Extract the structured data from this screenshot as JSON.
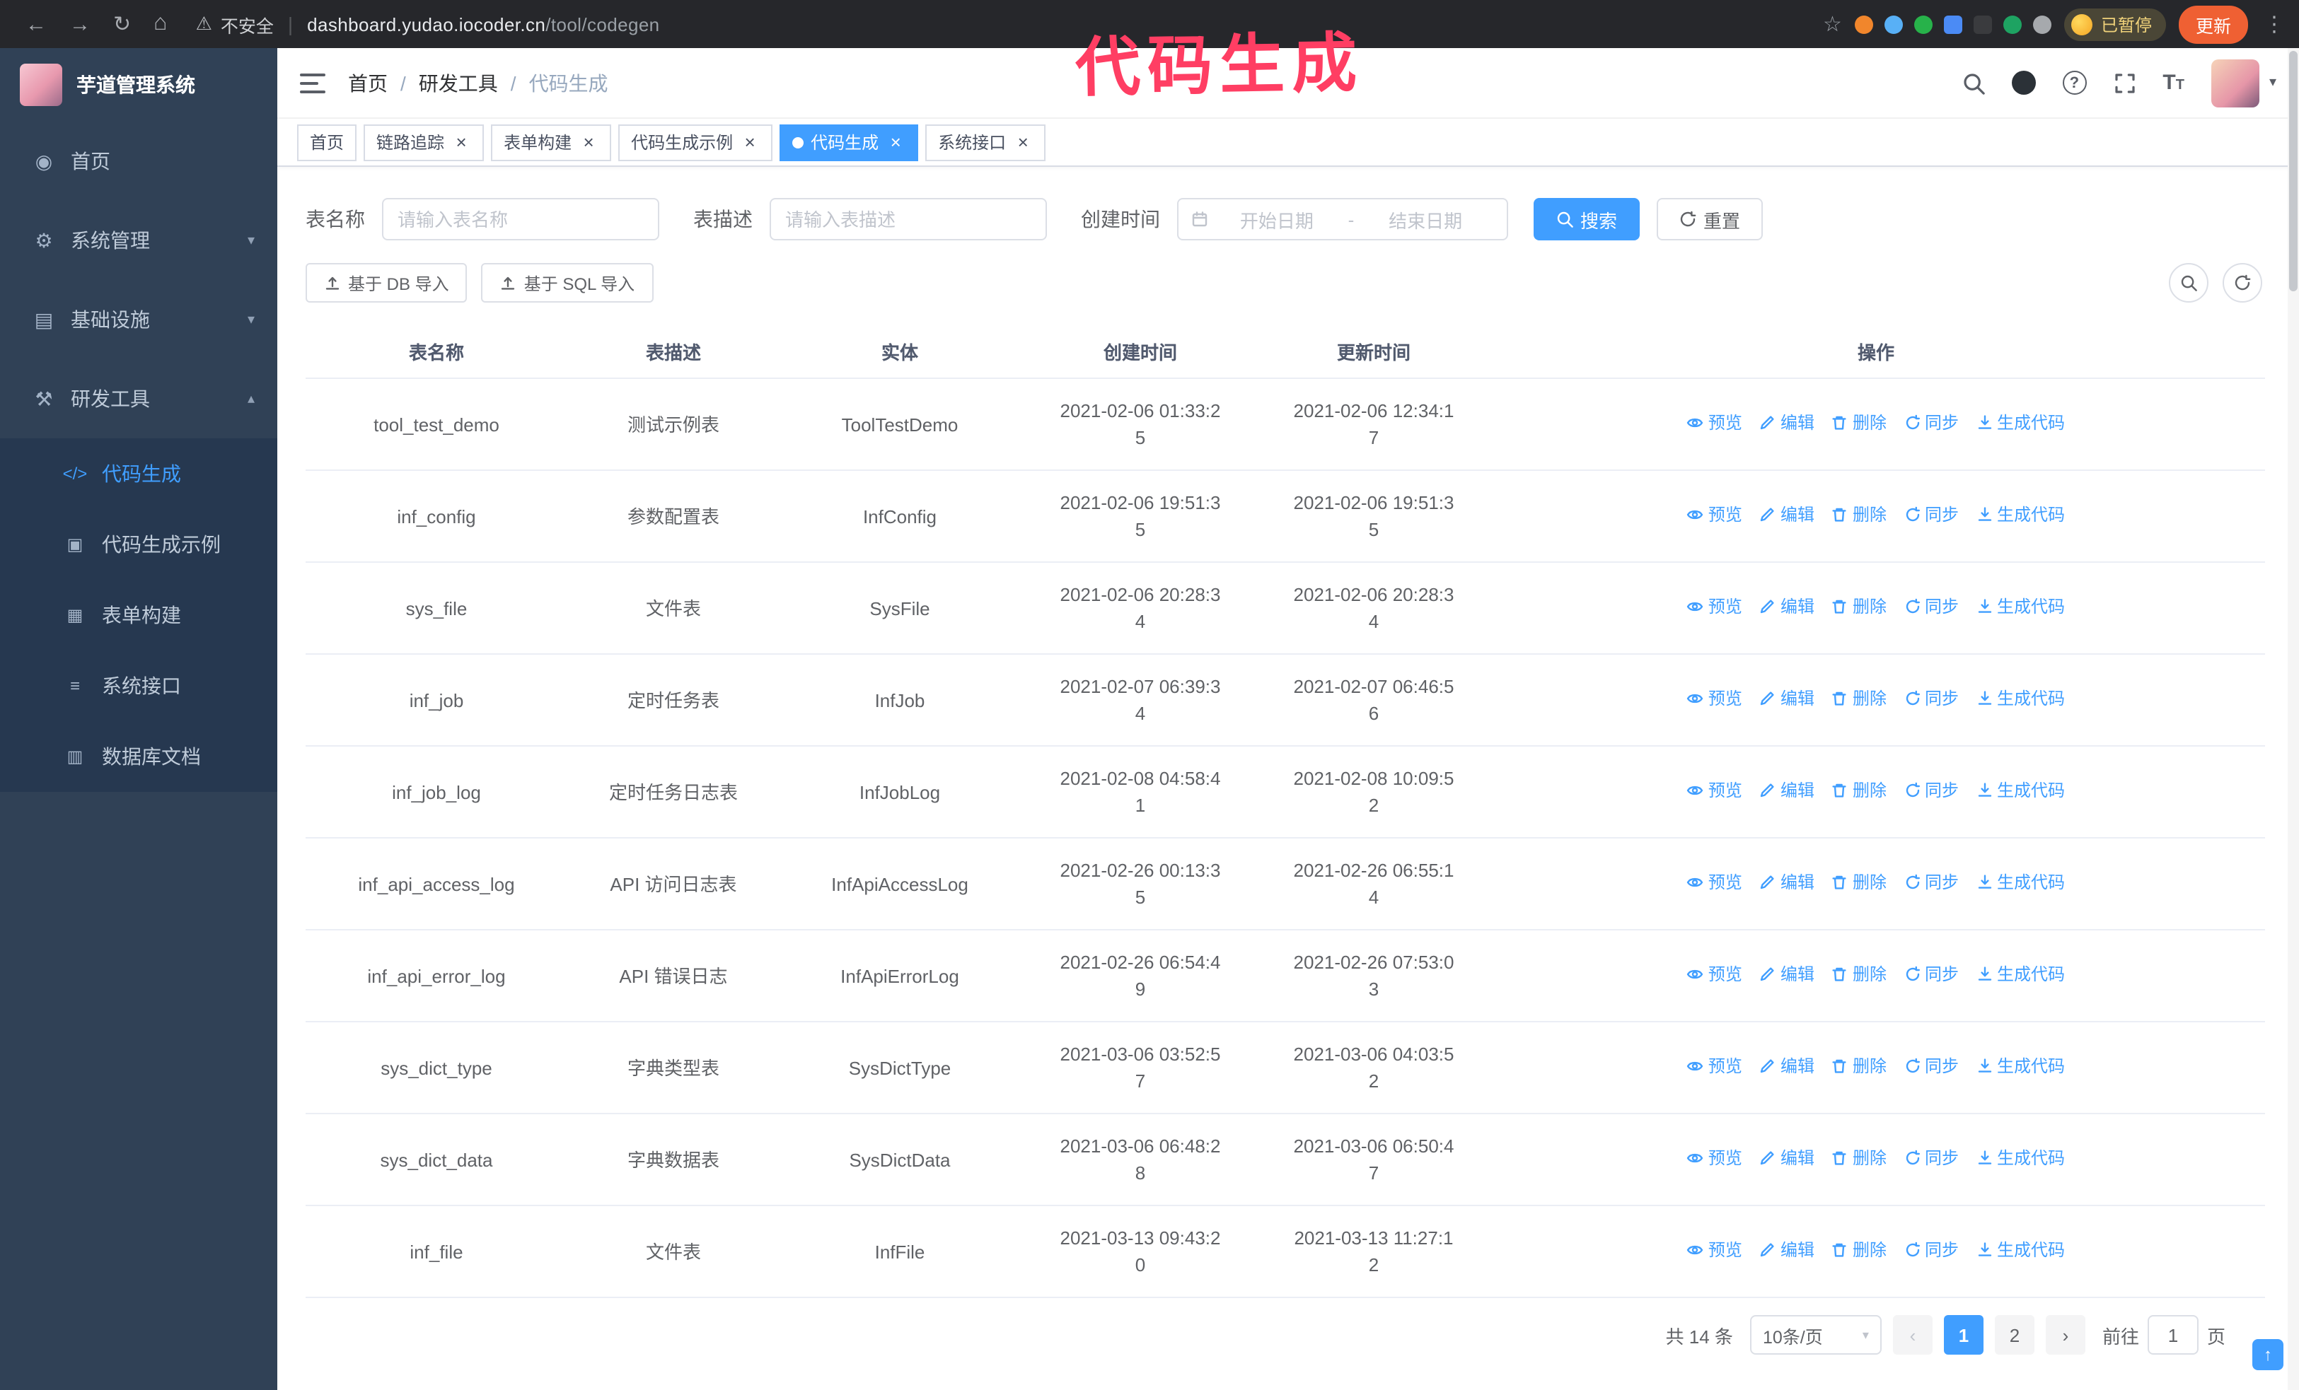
{
  "theme": {
    "primary": "#409eff",
    "sidebar_bg": "#304156",
    "submenu_bg": "#263850",
    "annotation_color": "#ff3e63"
  },
  "annotation": {
    "text": "代码生成"
  },
  "browser": {
    "security_text": "不安全",
    "url_host": "dashboard.yudao.iocoder.cn",
    "url_path": "/tool/codegen",
    "paused_badge": "已暂停",
    "update_button": "更新",
    "extensions": [
      {
        "icon": "extension-icon",
        "color": "#f1862c",
        "shape": "circle"
      },
      {
        "icon": "extension-icon",
        "color": "#58b0f6",
        "shape": "circle"
      },
      {
        "icon": "extension-icon",
        "color": "#27b24a",
        "shape": "circle"
      },
      {
        "icon": "extension-icon",
        "color": "#4b8bf5",
        "shape": "square"
      },
      {
        "icon": "extension-icon",
        "color": "#3a3b3e",
        "shape": "square"
      },
      {
        "icon": "extension-icon",
        "color": "#1ea362",
        "shape": "circle"
      },
      {
        "icon": "puzzle-icon",
        "color": "#a6a9ad",
        "shape": "circle"
      }
    ]
  },
  "sidebar": {
    "logo_title": "芋道管理系统",
    "items": [
      {
        "label": "首页",
        "icon": "dashboard-icon",
        "glyph": "◉"
      },
      {
        "label": "系统管理",
        "icon": "gear-icon",
        "glyph": "⚙",
        "chevron": "down"
      },
      {
        "label": "基础设施",
        "icon": "infrastructure-icon",
        "glyph": "▤",
        "chevron": "down"
      },
      {
        "label": "研发工具",
        "icon": "tools-icon",
        "glyph": "⚒",
        "chevron": "up",
        "expanded": true,
        "children": [
          {
            "label": "代码生成",
            "icon": "code-icon",
            "glyph": "</>",
            "active": true
          },
          {
            "label": "代码生成示例",
            "icon": "code-example-icon",
            "glyph": "▣",
            "active": false
          },
          {
            "label": "表单构建",
            "icon": "form-builder-icon",
            "glyph": "▦",
            "active": false
          },
          {
            "label": "系统接口",
            "icon": "api-icon",
            "glyph": "≡",
            "active": false
          },
          {
            "label": "数据库文档",
            "icon": "db-doc-icon",
            "glyph": "▥",
            "active": false
          }
        ]
      }
    ]
  },
  "header": {
    "breadcrumb": [
      "首页",
      "研发工具",
      "代码生成"
    ]
  },
  "tabs": [
    {
      "label": "首页",
      "closable": false,
      "active": false
    },
    {
      "label": "链路追踪",
      "closable": true,
      "active": false
    },
    {
      "label": "表单构建",
      "closable": true,
      "active": false
    },
    {
      "label": "代码生成示例",
      "closable": true,
      "active": false
    },
    {
      "label": "代码生成",
      "closable": true,
      "active": true
    },
    {
      "label": "系统接口",
      "closable": true,
      "active": false
    }
  ],
  "filters": {
    "table_name_label": "表名称",
    "table_name_placeholder": "请输入表名称",
    "table_desc_label": "表描述",
    "table_desc_placeholder": "请输入表描述",
    "create_time_label": "创建时间",
    "date_start_placeholder": "开始日期",
    "date_separator": "-",
    "date_end_placeholder": "结束日期",
    "search_button": "搜索",
    "reset_button": "重置"
  },
  "toolbar": {
    "import_db_button": "基于 DB 导入",
    "import_sql_button": "基于 SQL 导入"
  },
  "table": {
    "columns": [
      "表名称",
      "表描述",
      "实体",
      "创建时间",
      "更新时间",
      "操作"
    ],
    "actions": [
      "预览",
      "编辑",
      "删除",
      "同步",
      "生成代码"
    ],
    "rows": [
      {
        "name": "tool_test_demo",
        "desc": "测试示例表",
        "entity": "ToolTestDemo",
        "created": "2021-02-06 01:33:25",
        "updated": "2021-02-06 12:34:17"
      },
      {
        "name": "inf_config",
        "desc": "参数配置表",
        "entity": "InfConfig",
        "created": "2021-02-06 19:51:35",
        "updated": "2021-02-06 19:51:35"
      },
      {
        "name": "sys_file",
        "desc": "文件表",
        "entity": "SysFile",
        "created": "2021-02-06 20:28:34",
        "updated": "2021-02-06 20:28:34"
      },
      {
        "name": "inf_job",
        "desc": "定时任务表",
        "entity": "InfJob",
        "created": "2021-02-07 06:39:34",
        "updated": "2021-02-07 06:46:56"
      },
      {
        "name": "inf_job_log",
        "desc": "定时任务日志表",
        "entity": "InfJobLog",
        "created": "2021-02-08 04:58:41",
        "updated": "2021-02-08 10:09:52"
      },
      {
        "name": "inf_api_access_log",
        "desc": "API 访问日志表",
        "entity": "InfApiAccessLog",
        "created": "2021-02-26 00:13:35",
        "updated": "2021-02-26 06:55:14"
      },
      {
        "name": "inf_api_error_log",
        "desc": "API 错误日志",
        "entity": "InfApiErrorLog",
        "created": "2021-02-26 06:54:49",
        "updated": "2021-02-26 07:53:03"
      },
      {
        "name": "sys_dict_type",
        "desc": "字典类型表",
        "entity": "SysDictType",
        "created": "2021-03-06 03:52:57",
        "updated": "2021-03-06 04:03:52"
      },
      {
        "name": "sys_dict_data",
        "desc": "字典数据表",
        "entity": "SysDictData",
        "created": "2021-03-06 06:48:28",
        "updated": "2021-03-06 06:50:47"
      },
      {
        "name": "inf_file",
        "desc": "文件表",
        "entity": "InfFile",
        "created": "2021-03-13 09:43:20",
        "updated": "2021-03-13 11:27:12"
      }
    ]
  },
  "pagination": {
    "total": "共 14 条",
    "page_size": "10条/页",
    "pages": [
      "1",
      "2"
    ],
    "active_page": "1",
    "goto_label": "前往",
    "goto_value": "1",
    "unit_label": "页"
  }
}
